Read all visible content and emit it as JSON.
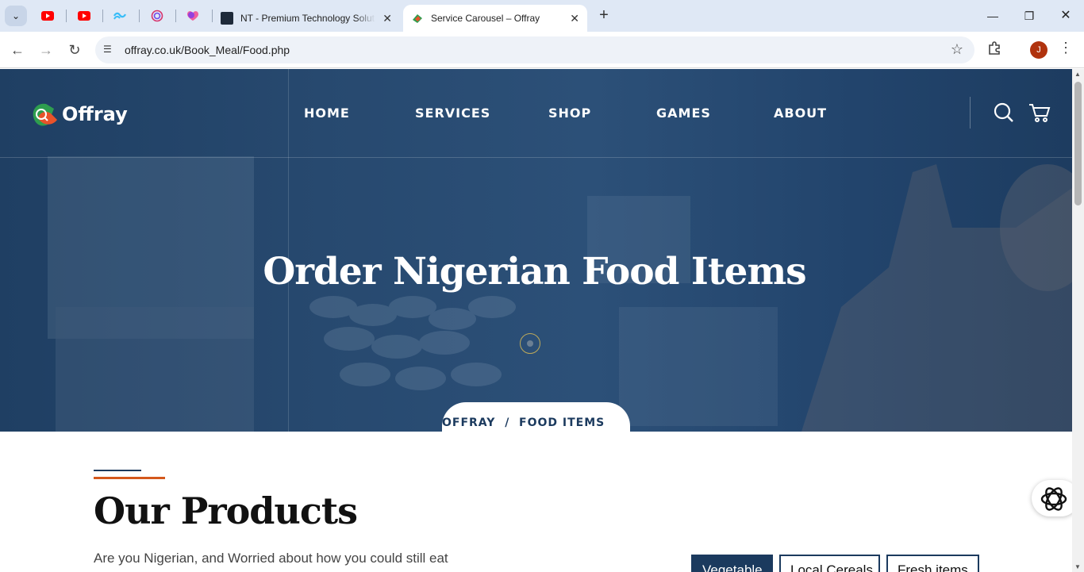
{
  "browser": {
    "pinned_tabs": [
      "youtube-icon",
      "youtube-icon",
      "tailwind-icon",
      "spiral-icon",
      "heart-icon"
    ],
    "tabs": [
      {
        "title": "NT - Premium Technology Solut",
        "favicon": "nt-icon",
        "active": false
      },
      {
        "title": "Service Carousel – Offray",
        "favicon": "offray-icon",
        "active": true
      }
    ],
    "url": "offray.co.uk/Book_Meal/Food.php",
    "profile_initial": "J"
  },
  "site": {
    "brand": "Offray",
    "nav": [
      "HOME",
      "SERVICES",
      "SHOP",
      "GAMES",
      "ABOUT"
    ],
    "hero_title": "Order Nigerian Food Items",
    "breadcrumb": "OFFRAY  /  FOOD ITEMS",
    "section_title": "Our Products",
    "intro": "Are you Nigerian, and Worried about how you could still eat",
    "filters": [
      "Vegetable",
      "Local Cereals",
      "Fresh items"
    ],
    "active_filter": "Vegetable",
    "colors": {
      "navy": "#1b3a5e",
      "accent": "#d4581c",
      "hero_overlay": "#27496f"
    }
  }
}
